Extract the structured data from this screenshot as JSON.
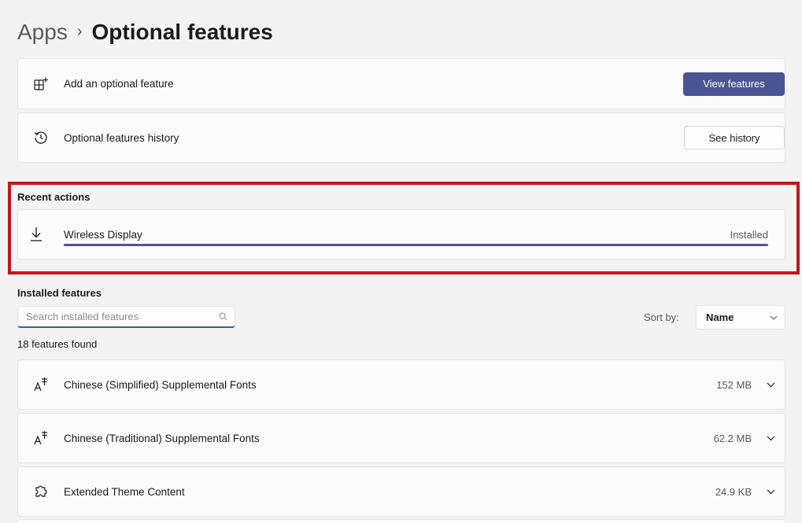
{
  "breadcrumb": {
    "parent": "Apps",
    "separator": "›",
    "current": "Optional features"
  },
  "add_feature": {
    "icon": "add-grid-icon",
    "label": "Add an optional feature",
    "button": "View features"
  },
  "history": {
    "icon": "history-icon",
    "label": "Optional features history",
    "button": "See history"
  },
  "recent_actions": {
    "title": "Recent actions",
    "items": [
      {
        "icon": "download-icon",
        "name": "Wireless Display",
        "status": "Installed",
        "progress": 1.0
      }
    ]
  },
  "installed": {
    "title": "Installed features",
    "search_placeholder": "Search installed features",
    "search_value": "",
    "sort_label": "Sort by:",
    "sort_value": "Name",
    "count_text": "18 features found",
    "features": [
      {
        "icon": "font-icon",
        "name": "Chinese (Simplified) Supplemental Fonts",
        "size": "152 MB"
      },
      {
        "icon": "font-icon",
        "name": "Chinese (Traditional) Supplemental Fonts",
        "size": "62.2 MB"
      },
      {
        "icon": "puzzle-icon",
        "name": "Extended Theme Content",
        "size": "24.9 KB"
      }
    ]
  },
  "colors": {
    "accent": "#4b5596",
    "highlight_border": "#c4161c",
    "background": "#f3f3f3",
    "card": "#fbfbfb"
  }
}
